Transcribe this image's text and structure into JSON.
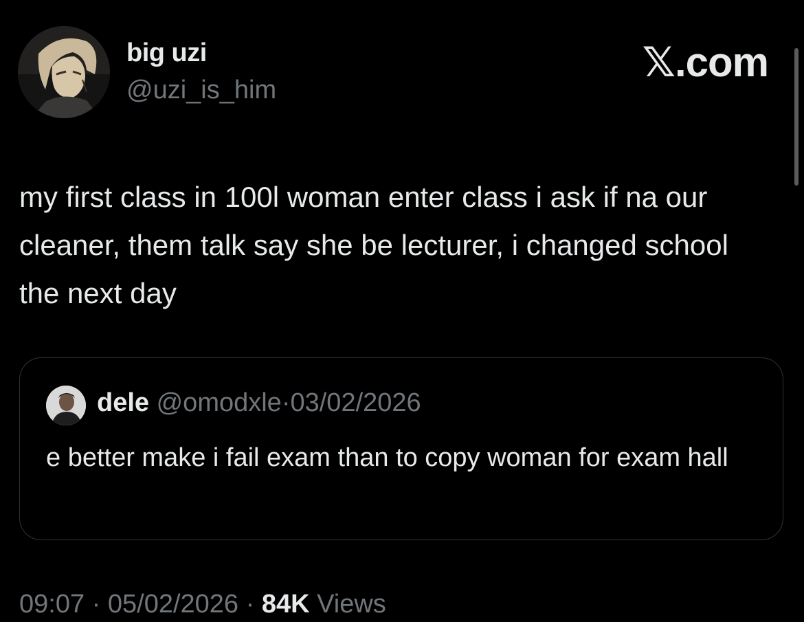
{
  "brand": {
    "label": "𝕏.com"
  },
  "author": {
    "display_name": "big uzi",
    "handle": "@uzi_is_him"
  },
  "tweet": {
    "text": "my first class in 100l woman enter class i ask if na our cleaner, them talk say she be lecturer, i changed school the next day"
  },
  "quoted_tweet": {
    "display_name": "dele",
    "handle": "@omodxle",
    "separator": "·",
    "date": "03/02/2026",
    "text": "e better make i fail exam than to copy woman for exam hall"
  },
  "meta": {
    "time": "09:07",
    "separator": "·",
    "date": "05/02/2026",
    "views_count": "84K",
    "views_label": "Views"
  },
  "colors": {
    "background": "#000000",
    "primary_text": "#e7e9ea",
    "secondary_text": "#71767b",
    "border": "#2f3336"
  },
  "icons": {
    "author_avatar": "anime-character-avatar",
    "quote_avatar": "person-photo-avatar"
  }
}
